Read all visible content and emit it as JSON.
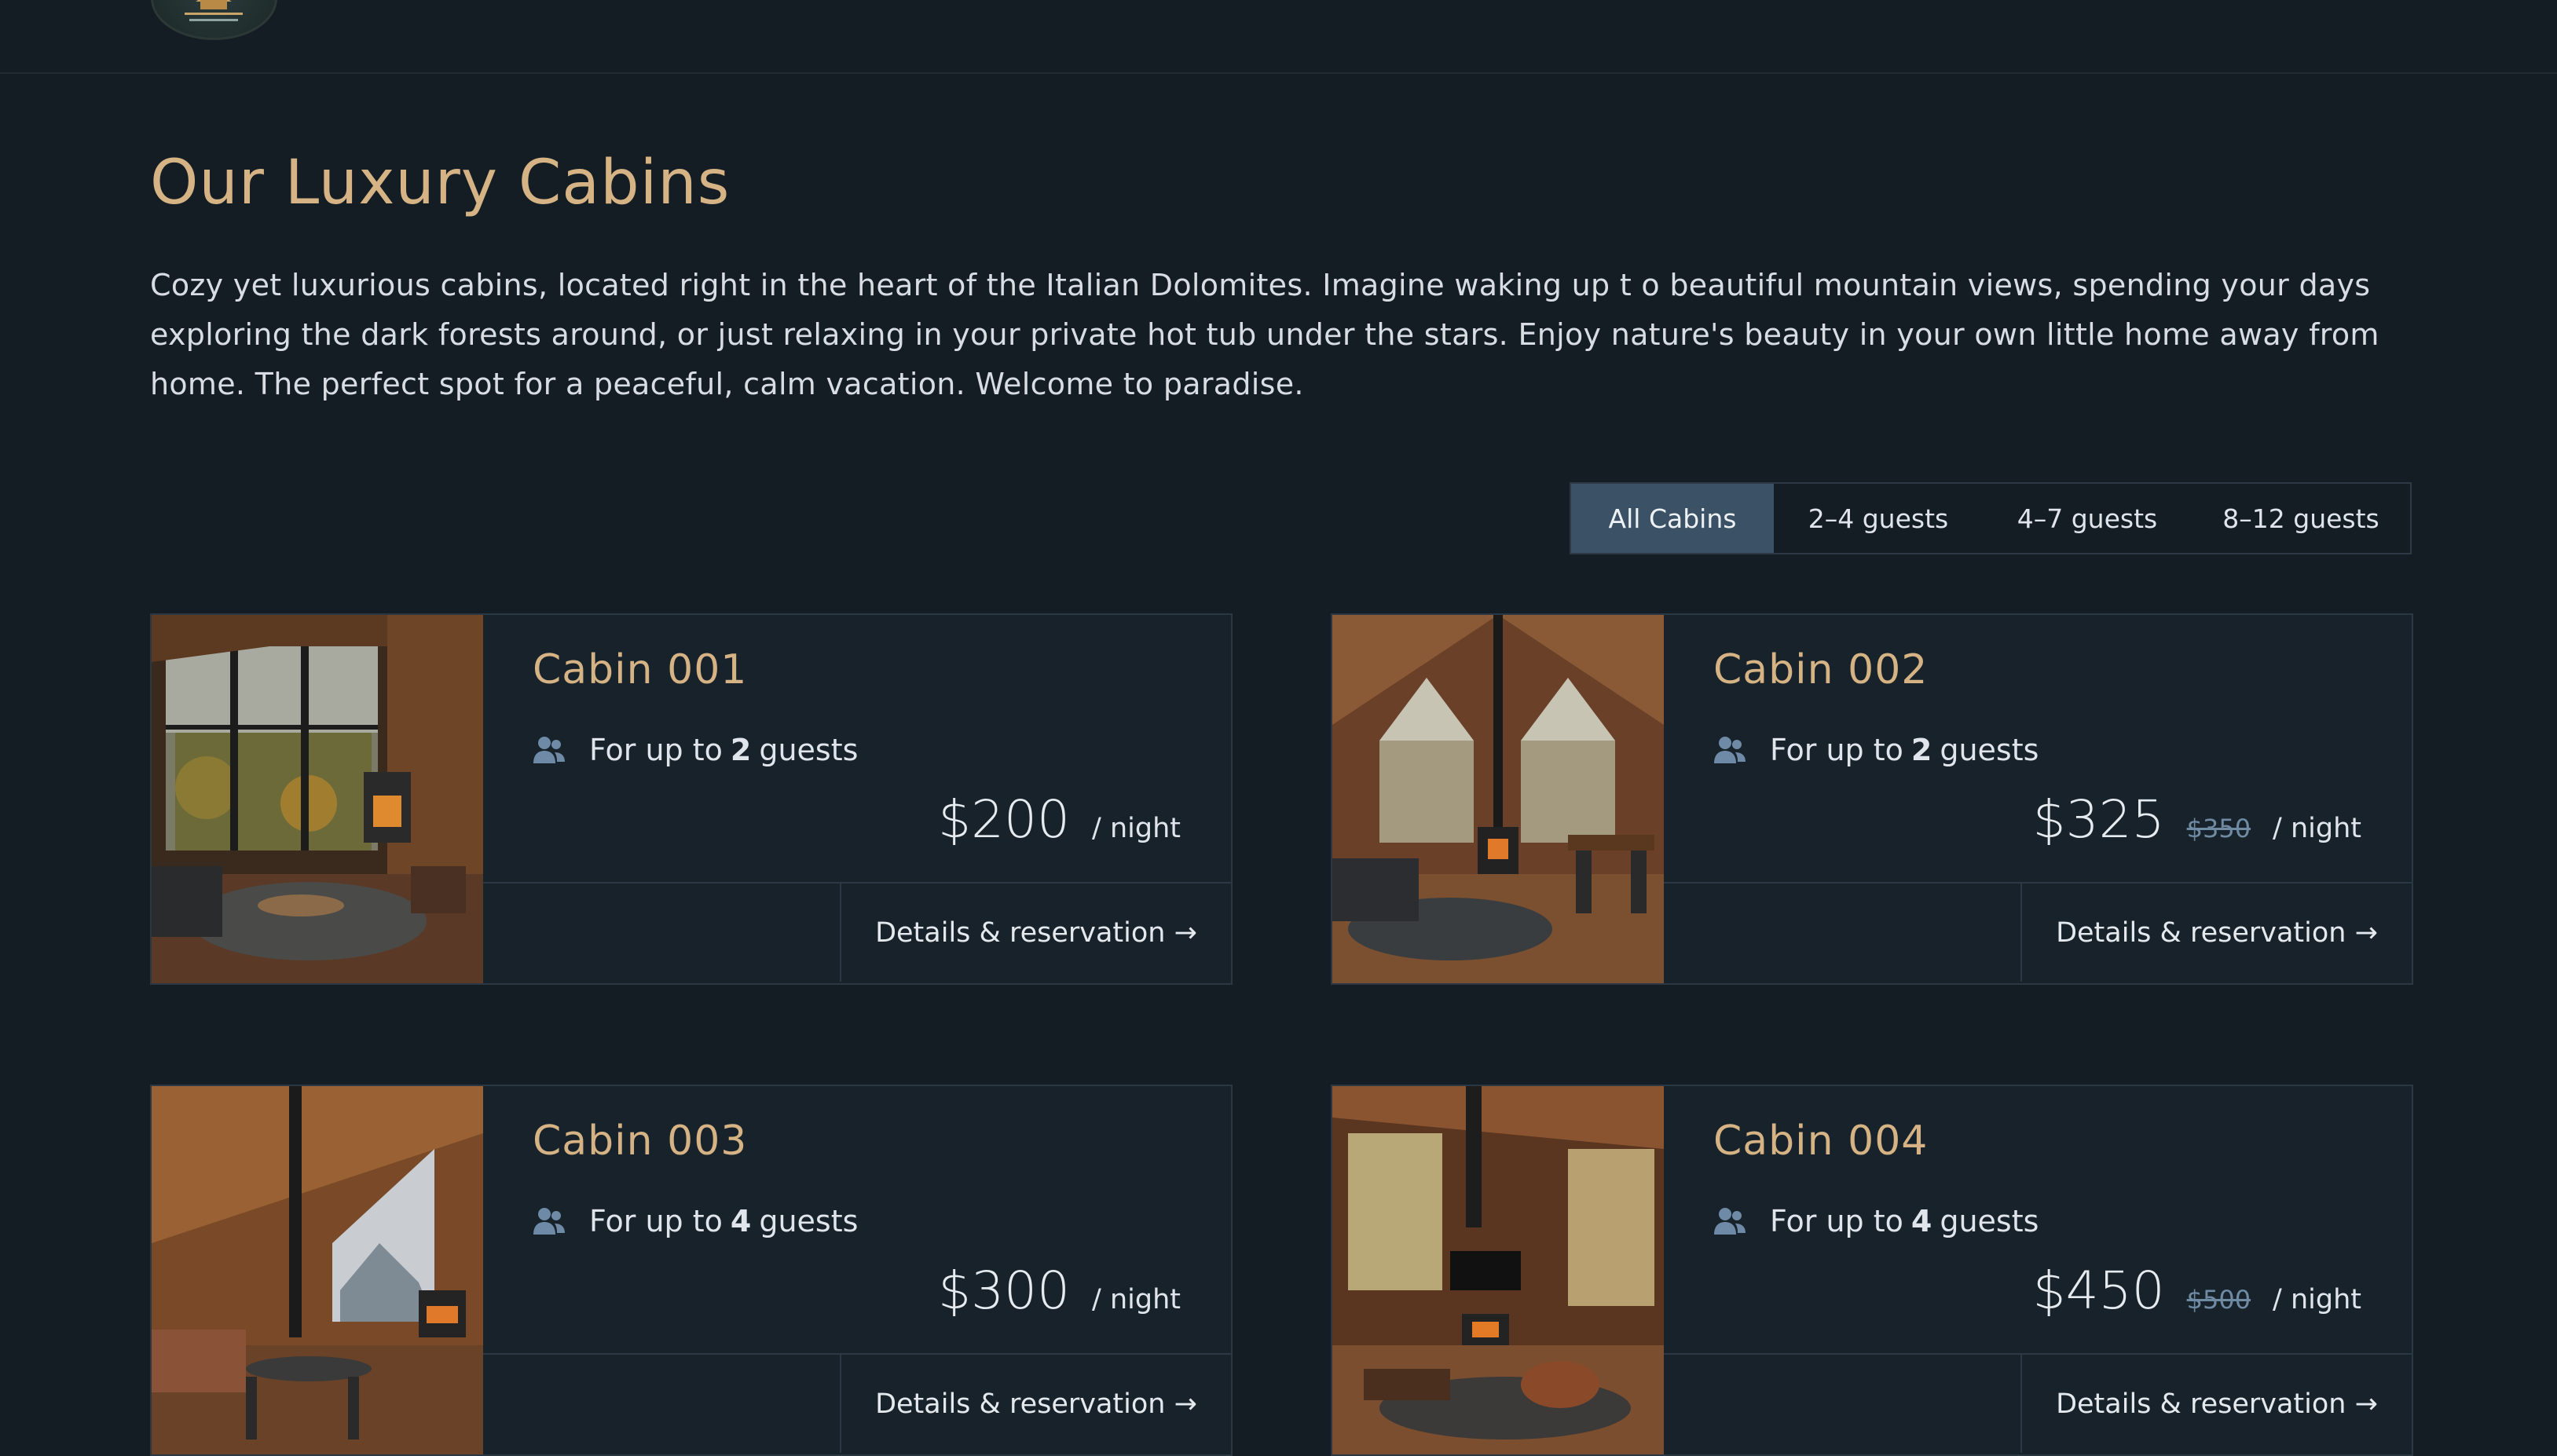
{
  "header": {
    "logo_icon": "cabin-logo-icon"
  },
  "main": {
    "title": "Our Luxury Cabins",
    "intro": "Cozy yet luxurious cabins, located right in the heart of the Italian Dolomites. Imagine waking up t o beautiful mountain views, spending your days exploring the dark forests around, or just relaxing in your private hot tub under the stars. Enjoy nature's beauty in your own little home away from home. The perfect spot for a peaceful, calm vacation. Welcome to paradise."
  },
  "filter": {
    "options": [
      {
        "label": "All Cabins",
        "active": true
      },
      {
        "label": "2–4 guests",
        "active": false
      },
      {
        "label": "4–7 guests",
        "active": false
      },
      {
        "label": "8–12 guests",
        "active": false
      }
    ]
  },
  "cabins": [
    {
      "name": "Cabin 001",
      "guests_prefix": "For up to",
      "guests_count": "2",
      "guests_suffix": "guests",
      "price": "$200",
      "old_price": "",
      "per_night": "/ night",
      "details_label": "Details & reservation →"
    },
    {
      "name": "Cabin 002",
      "guests_prefix": "For up to",
      "guests_count": "2",
      "guests_suffix": "guests",
      "price": "$325",
      "old_price": "$350",
      "per_night": "/ night",
      "details_label": "Details & reservation →"
    },
    {
      "name": "Cabin 003",
      "guests_prefix": "For up to",
      "guests_count": "4",
      "guests_suffix": "guests",
      "price": "$300",
      "old_price": "",
      "per_night": "/ night",
      "details_label": "Details & reservation →"
    },
    {
      "name": "Cabin 004",
      "guests_prefix": "For up to",
      "guests_count": "4",
      "guests_suffix": "guests",
      "price": "$450",
      "old_price": "$500",
      "per_night": "/ night",
      "details_label": "Details & reservation →"
    }
  ],
  "colors": {
    "background": "#141d24",
    "accent_gold": "#d5b384",
    "active_filter": "#3a5166",
    "icon_blue": "#6e8aa6"
  }
}
